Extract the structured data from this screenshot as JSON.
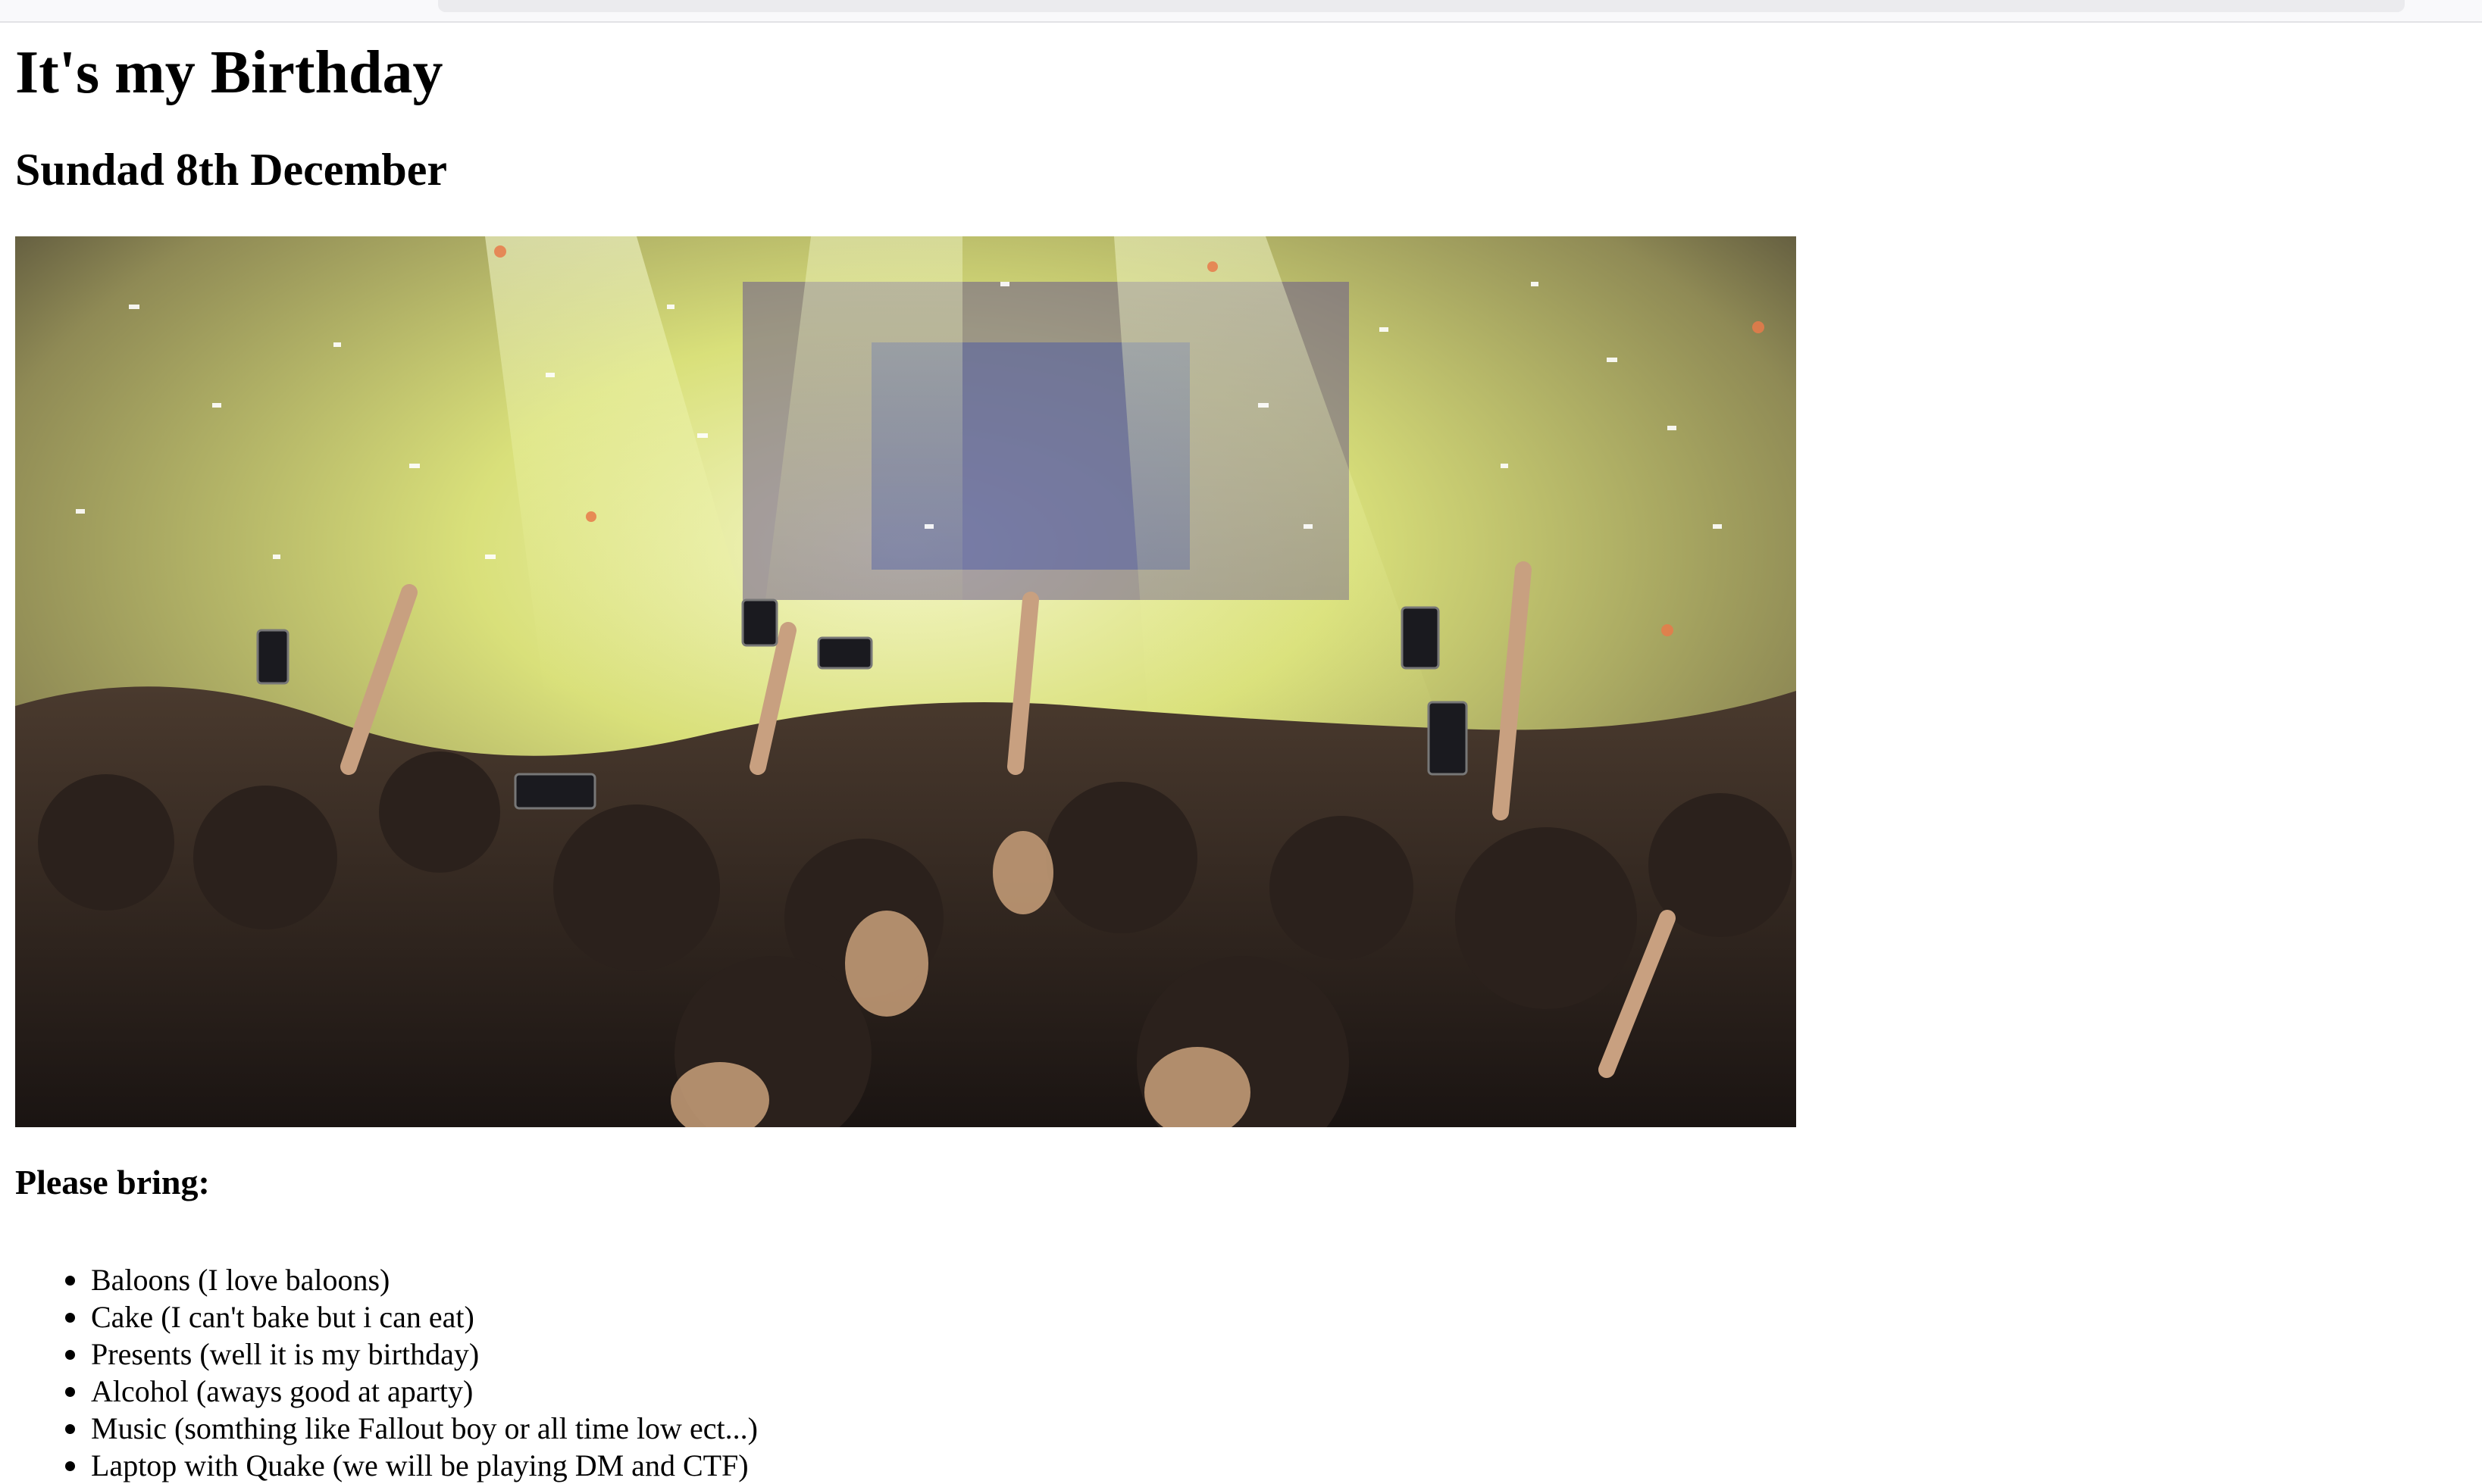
{
  "page": {
    "title": "It's my Birthday",
    "date": "Sundad 8th December",
    "bring_heading": "Please bring:",
    "bring_items": [
      "Baloons (I love baloons)",
      "Cake (I can't bake but i can eat)",
      "Presents (well it is my birthday)",
      "Alcohol (aways good at aparty)",
      "Music (somthing like Fallout boy or all time low ect...)",
      "Laptop with Quake (we will be playing DM and CTF)"
    ]
  },
  "photo": {
    "subject": "concert-crowd-confetti-photo",
    "colors": {
      "haze": "#d9e07a",
      "glow": "#f4f6c8",
      "crowd": "#2b211c",
      "stage": "#6a5a8c",
      "confetti": "#ffffff"
    }
  },
  "chrome": {
    "topbar_color": "#f9f9fb",
    "scroll_track_color": "#ebebee"
  }
}
